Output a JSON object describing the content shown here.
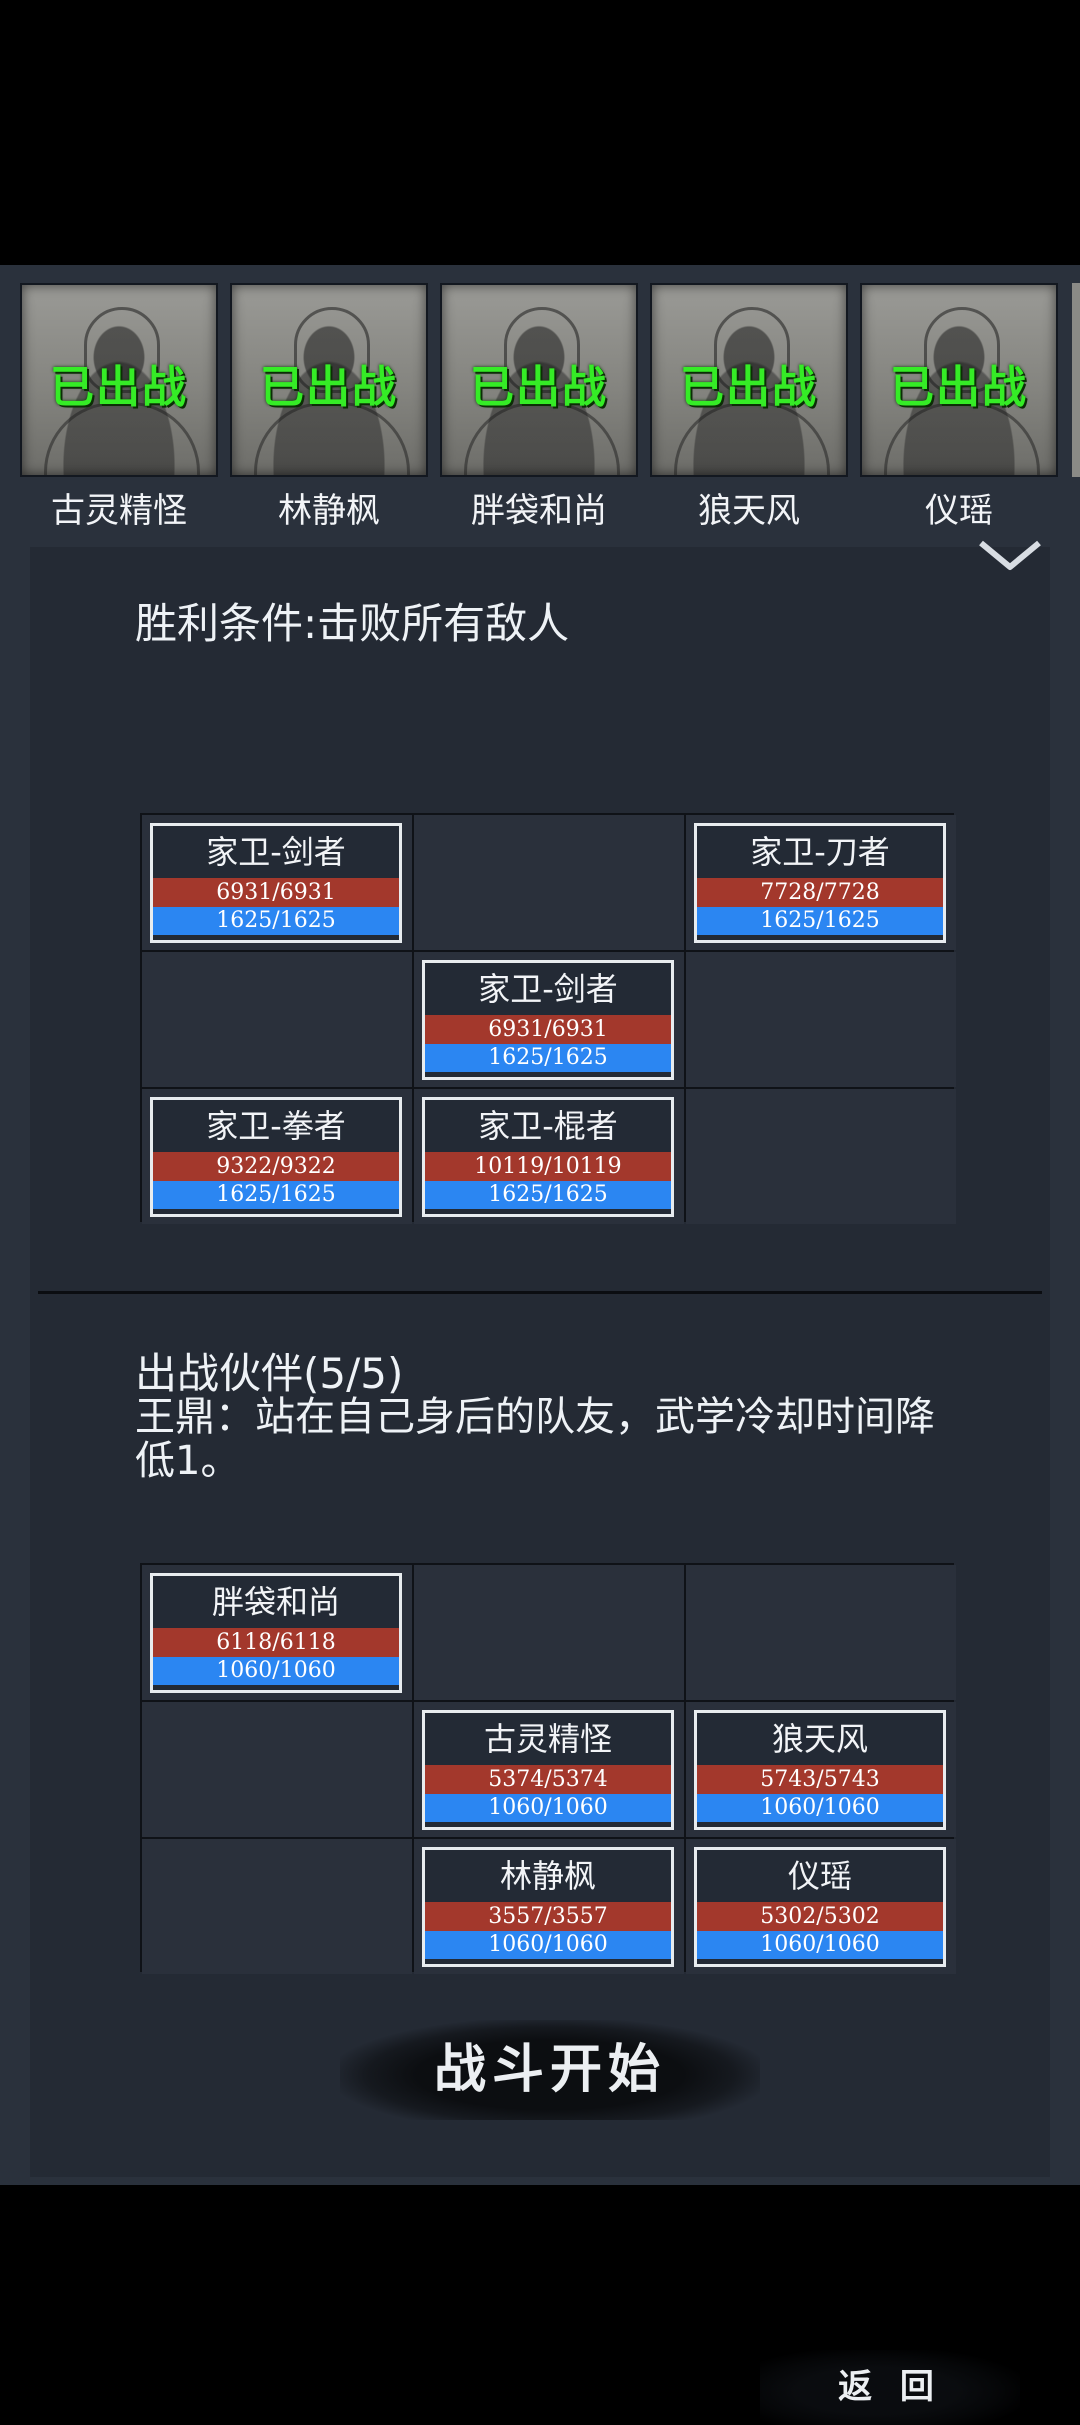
{
  "roster": {
    "status_label": "已出战",
    "heroes": [
      {
        "name": "古灵精怪"
      },
      {
        "name": "林静枫"
      },
      {
        "name": "胖袋和尚"
      },
      {
        "name": "狼天风"
      },
      {
        "name": "仪瑶"
      }
    ]
  },
  "victory_condition": "胜利条件:击败所有敌人",
  "enemy_grid": [
    {
      "name": "家卫-剑者",
      "hp": "6931/6931",
      "mp": "1625/1625"
    },
    null,
    {
      "name": "家卫-刀者",
      "hp": "7728/7728",
      "mp": "1625/1625"
    },
    null,
    {
      "name": "家卫-剑者",
      "hp": "6931/6931",
      "mp": "1625/1625"
    },
    null,
    {
      "name": "家卫-拳者",
      "hp": "9322/9322",
      "mp": "1625/1625"
    },
    {
      "name": "家卫-棍者",
      "hp": "10119/10119",
      "mp": "1625/1625"
    },
    null
  ],
  "party": {
    "title": "出战伙伴(5/5)",
    "description": "王鼎：站在自己身后的队友，武学冷却时间降低1。"
  },
  "ally_grid": [
    {
      "name": "胖袋和尚",
      "hp": "6118/6118",
      "mp": "1060/1060"
    },
    null,
    null,
    null,
    {
      "name": "古灵精怪",
      "hp": "5374/5374",
      "mp": "1060/1060"
    },
    {
      "name": "狼天风",
      "hp": "5743/5743",
      "mp": "1060/1060"
    },
    null,
    {
      "name": "林静枫",
      "hp": "3557/3557",
      "mp": "1060/1060"
    },
    {
      "name": "仪瑶",
      "hp": "5302/5302",
      "mp": "1060/1060"
    }
  ],
  "buttons": {
    "start": "战斗开始",
    "back": "返 回"
  },
  "colors": {
    "deployed_green": "#35ec26",
    "hp_red": "#a3382c",
    "mp_blue": "#2b86f2"
  },
  "icons": {
    "collapse": "chevron-down-icon"
  }
}
